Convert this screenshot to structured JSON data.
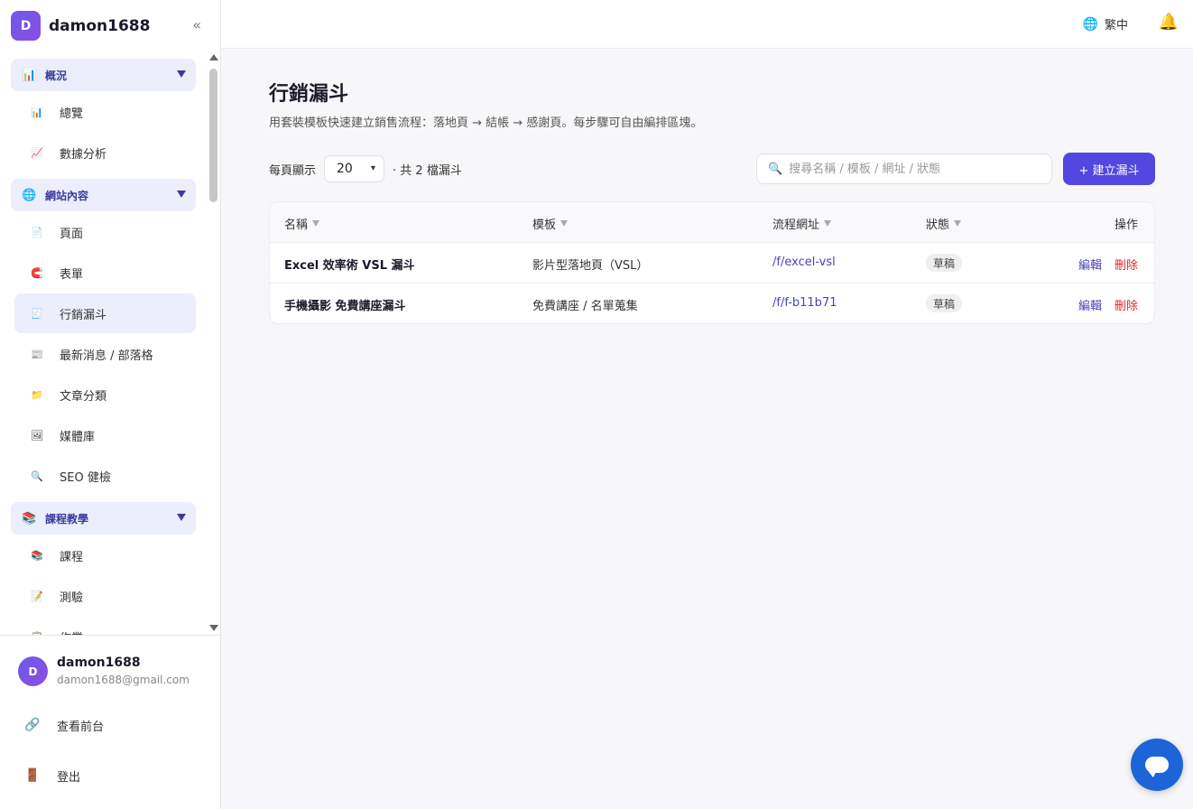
{
  "brand": {
    "logo_letter": "D",
    "name": "damon1688",
    "collapse_icon": "«"
  },
  "sidebar": {
    "sections": [
      {
        "label": "概況",
        "icon": "chart-icon",
        "glyph": "📊"
      },
      {
        "label": "網站內容",
        "icon": "globe-icon",
        "glyph": "🌐"
      },
      {
        "label": "課程教學",
        "icon": "books-icon",
        "glyph": "📚"
      }
    ],
    "items": [
      {
        "label": "總覽",
        "icon": "bar-chart-icon",
        "glyph": "📊"
      },
      {
        "label": "數據分析",
        "icon": "line-chart-icon",
        "glyph": "📈"
      },
      {
        "label": "頁面",
        "icon": "page-icon",
        "glyph": "📄"
      },
      {
        "label": "表單",
        "icon": "magnet-icon",
        "glyph": "🧲"
      },
      {
        "label": "行銷漏斗",
        "icon": "clipboard-icon",
        "glyph": "🧾"
      },
      {
        "label": "最新消息 / 部落格",
        "icon": "newspaper-icon",
        "glyph": "📰"
      },
      {
        "label": "文章分類",
        "icon": "folder-icon",
        "glyph": "📁"
      },
      {
        "label": "媒體庫",
        "icon": "image-icon",
        "glyph": "🖼"
      },
      {
        "label": "SEO 健檢",
        "icon": "magnifier-icon",
        "glyph": "🔍"
      },
      {
        "label": "課程",
        "icon": "books-icon",
        "glyph": "📚"
      },
      {
        "label": "測驗",
        "icon": "memo-icon",
        "glyph": "📝"
      },
      {
        "label": "作業",
        "icon": "clipboard-icon",
        "glyph": "📋"
      }
    ]
  },
  "user": {
    "avatar_letter": "D",
    "name": "damon1688",
    "email": "damon1688@gmail.com",
    "view_frontend": "查看前台",
    "logout": "登出"
  },
  "topbar": {
    "lang_label": "繁中",
    "lang_icon": "globe-icon",
    "bell_icon": "bell-icon"
  },
  "main": {
    "title": "行銷漏斗",
    "subtitle": "用套裝模板快速建立銷售流程：落地頁 → 結帳 → 感謝頁。每步驟可自由編排區塊。",
    "per_page_label": "每頁顯示",
    "per_page_value": "20",
    "total_label": "· 共 2 檔漏斗",
    "search_placeholder": "搜尋名稱 / 模板 / 網址 / 狀態",
    "create_button": "+ 建立漏斗"
  },
  "table": {
    "headers": {
      "name": "名稱",
      "template": "模板",
      "url": "流程網址",
      "status": "狀態",
      "actions": "操作"
    },
    "rows": [
      {
        "name": "Excel 效率術 VSL 漏斗",
        "template": "影片型落地頁（VSL）",
        "url": "/f/excel-vsl",
        "status": "草稿",
        "edit": "編輯",
        "delete": "刪除"
      },
      {
        "name": "手機攝影 免費講座漏斗",
        "template": "免費講座 / 名單蒐集",
        "url": "/f/f-b11b71",
        "status": "草稿",
        "edit": "編輯",
        "delete": "刪除"
      }
    ]
  },
  "colors": {
    "accent": "#5247e0",
    "link": "#4a44b8",
    "danger": "#d62b2b",
    "chat": "#1d64d8"
  }
}
